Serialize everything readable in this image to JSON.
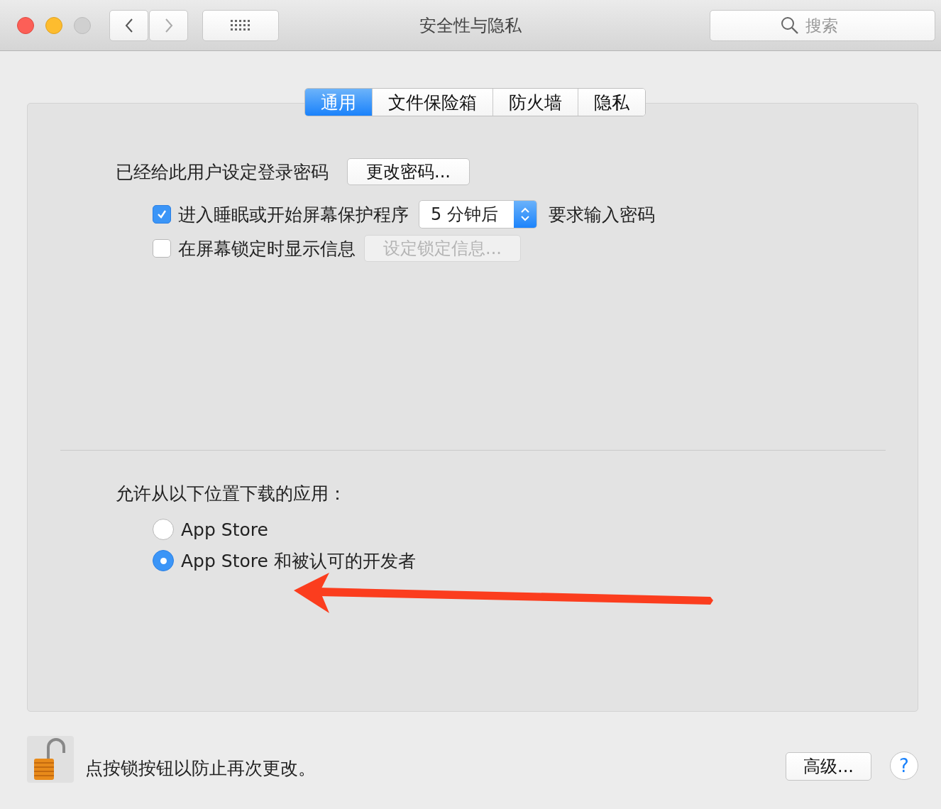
{
  "window": {
    "title": "安全性与隐私"
  },
  "search": {
    "placeholder": "搜索"
  },
  "tabs": [
    {
      "label": "通用",
      "selected": true
    },
    {
      "label": "文件保险箱",
      "selected": false
    },
    {
      "label": "防火墙",
      "selected": false
    },
    {
      "label": "隐私",
      "selected": false
    }
  ],
  "password": {
    "label": "已经给此用户设定登录密码",
    "button": "更改密码..."
  },
  "options": [
    {
      "kind": "select",
      "checked": true,
      "label": "进入睡眠或开始屏幕保护程序",
      "value": "5 分钟后",
      "suffix": "要求输入密码"
    },
    {
      "kind": "button",
      "checked": false,
      "label": "在屏幕锁定时显示信息",
      "button": "设定锁定信息...",
      "disabled": true
    }
  ],
  "downloads": {
    "title": "允许从以下位置下载的应用：",
    "options": [
      {
        "label": "App Store",
        "selected": false
      },
      {
        "label": "App Store 和被认可的开发者",
        "selected": true
      }
    ]
  },
  "footer": {
    "lock_text": "点按锁按钮以防止再次更改。",
    "advanced": "高级...",
    "help": "?"
  }
}
